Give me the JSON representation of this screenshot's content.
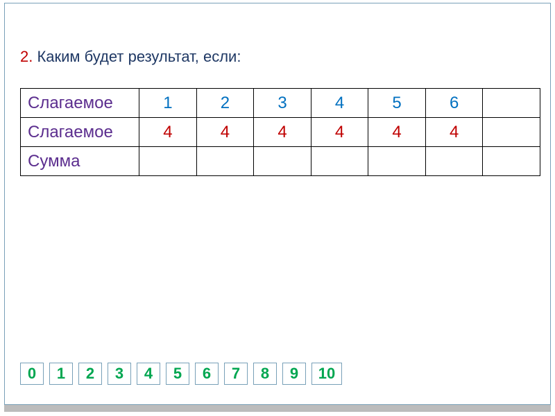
{
  "question": {
    "number": "2.",
    "text": " Каким будет результат, если:"
  },
  "table": {
    "rows": [
      {
        "label": "Слагаемое",
        "cells": [
          "1",
          "2",
          "3",
          "4",
          "5",
          "6",
          ""
        ]
      },
      {
        "label": "Слагаемое",
        "cells": [
          "4",
          "4",
          "4",
          "4",
          "4",
          "4",
          ""
        ]
      },
      {
        "label": "Сумма",
        "cells": [
          "",
          "",
          "",
          "",
          "",
          "",
          ""
        ]
      }
    ]
  },
  "numberline": [
    "0",
    "1",
    "2",
    "3",
    "4",
    "5",
    "6",
    "7",
    "8",
    "9",
    "10"
  ],
  "chart_data": {
    "type": "table",
    "title": "Каким будет результат, если:",
    "columns": [
      "Слагаемое",
      "Слагаемое",
      "Сумма"
    ],
    "rows": [
      {
        "addend1": 1,
        "addend2": 4,
        "sum": null
      },
      {
        "addend1": 2,
        "addend2": 4,
        "sum": null
      },
      {
        "addend1": 3,
        "addend2": 4,
        "sum": null
      },
      {
        "addend1": 4,
        "addend2": 4,
        "sum": null
      },
      {
        "addend1": 5,
        "addend2": 4,
        "sum": null
      },
      {
        "addend1": 6,
        "addend2": 4,
        "sum": null
      },
      {
        "addend1": null,
        "addend2": null,
        "sum": null
      }
    ]
  }
}
